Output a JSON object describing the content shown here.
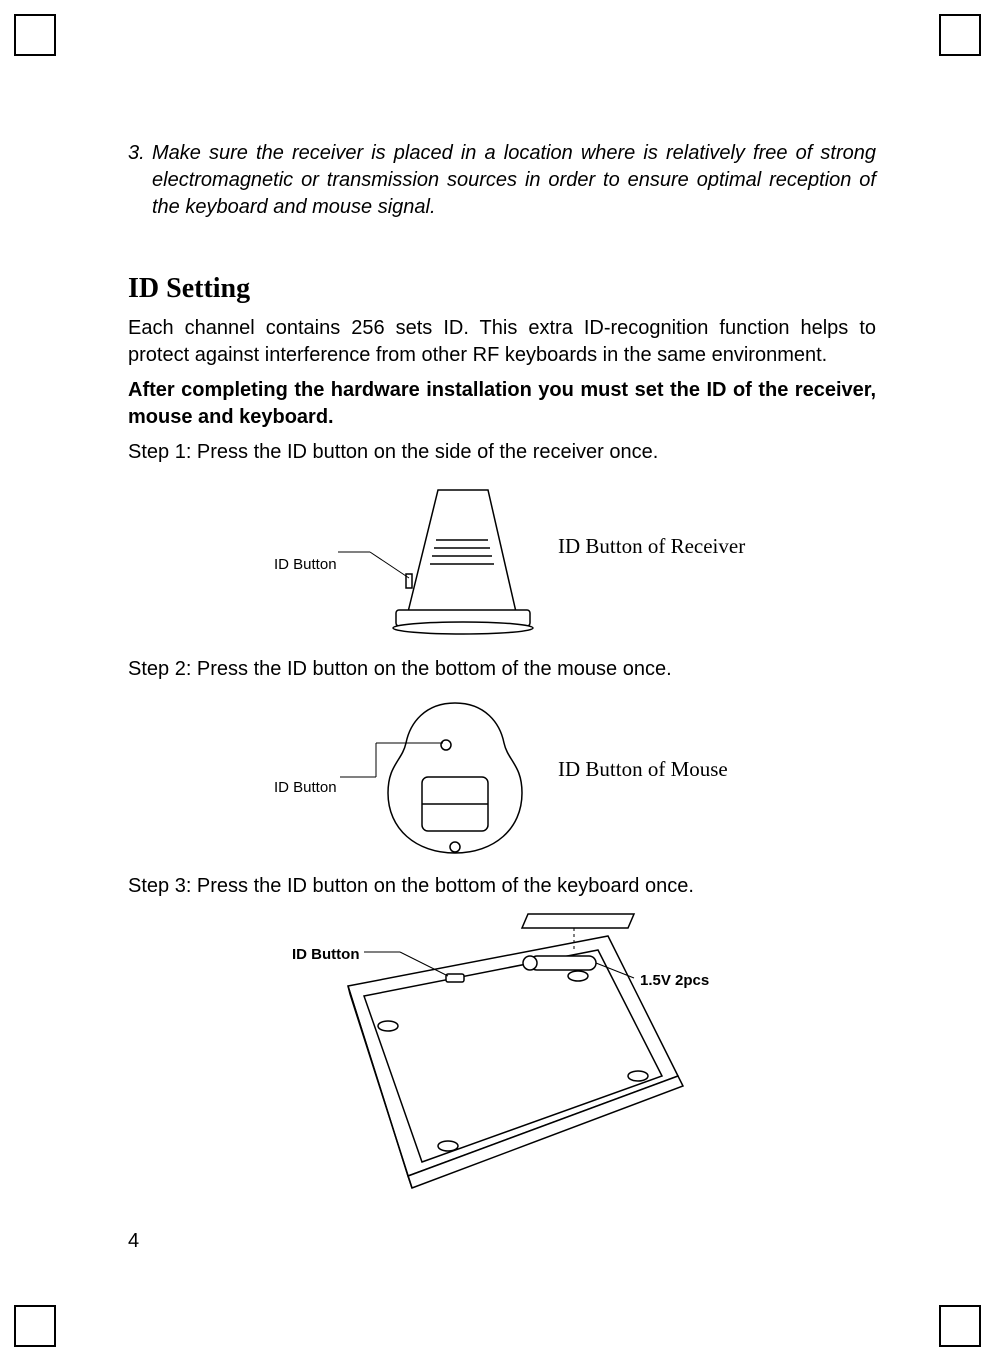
{
  "note": {
    "number": "3.",
    "text": "Make sure the receiver is placed in a location where is relatively free of strong electromagnetic or transmission sources in order to ensure optimal reception of the keyboard and mouse signal."
  },
  "section_title": "ID Setting",
  "intro_para": "Each channel contains 256 sets ID. This extra ID-recognition function helps to protect against interference from other RF keyboards in the same environment.",
  "bold_para": "After completing the hardware installation you must set the ID of the receiver, mouse and keyboard.",
  "step1": "Step 1: Press the ID button on the side of the receiver once.",
  "step2": "Step 2:   Press the ID button on the bottom of the mouse once.",
  "step3": "Step 3: Press the ID button on the bottom of the keyboard once.",
  "fig1": {
    "label": "ID Button",
    "caption": "ID Button of Receiver"
  },
  "fig2": {
    "label": "ID Button",
    "caption": "ID Button of Mouse"
  },
  "fig3": {
    "label": "ID Button",
    "battery": "1.5V 2pcs"
  },
  "page_number": "4"
}
